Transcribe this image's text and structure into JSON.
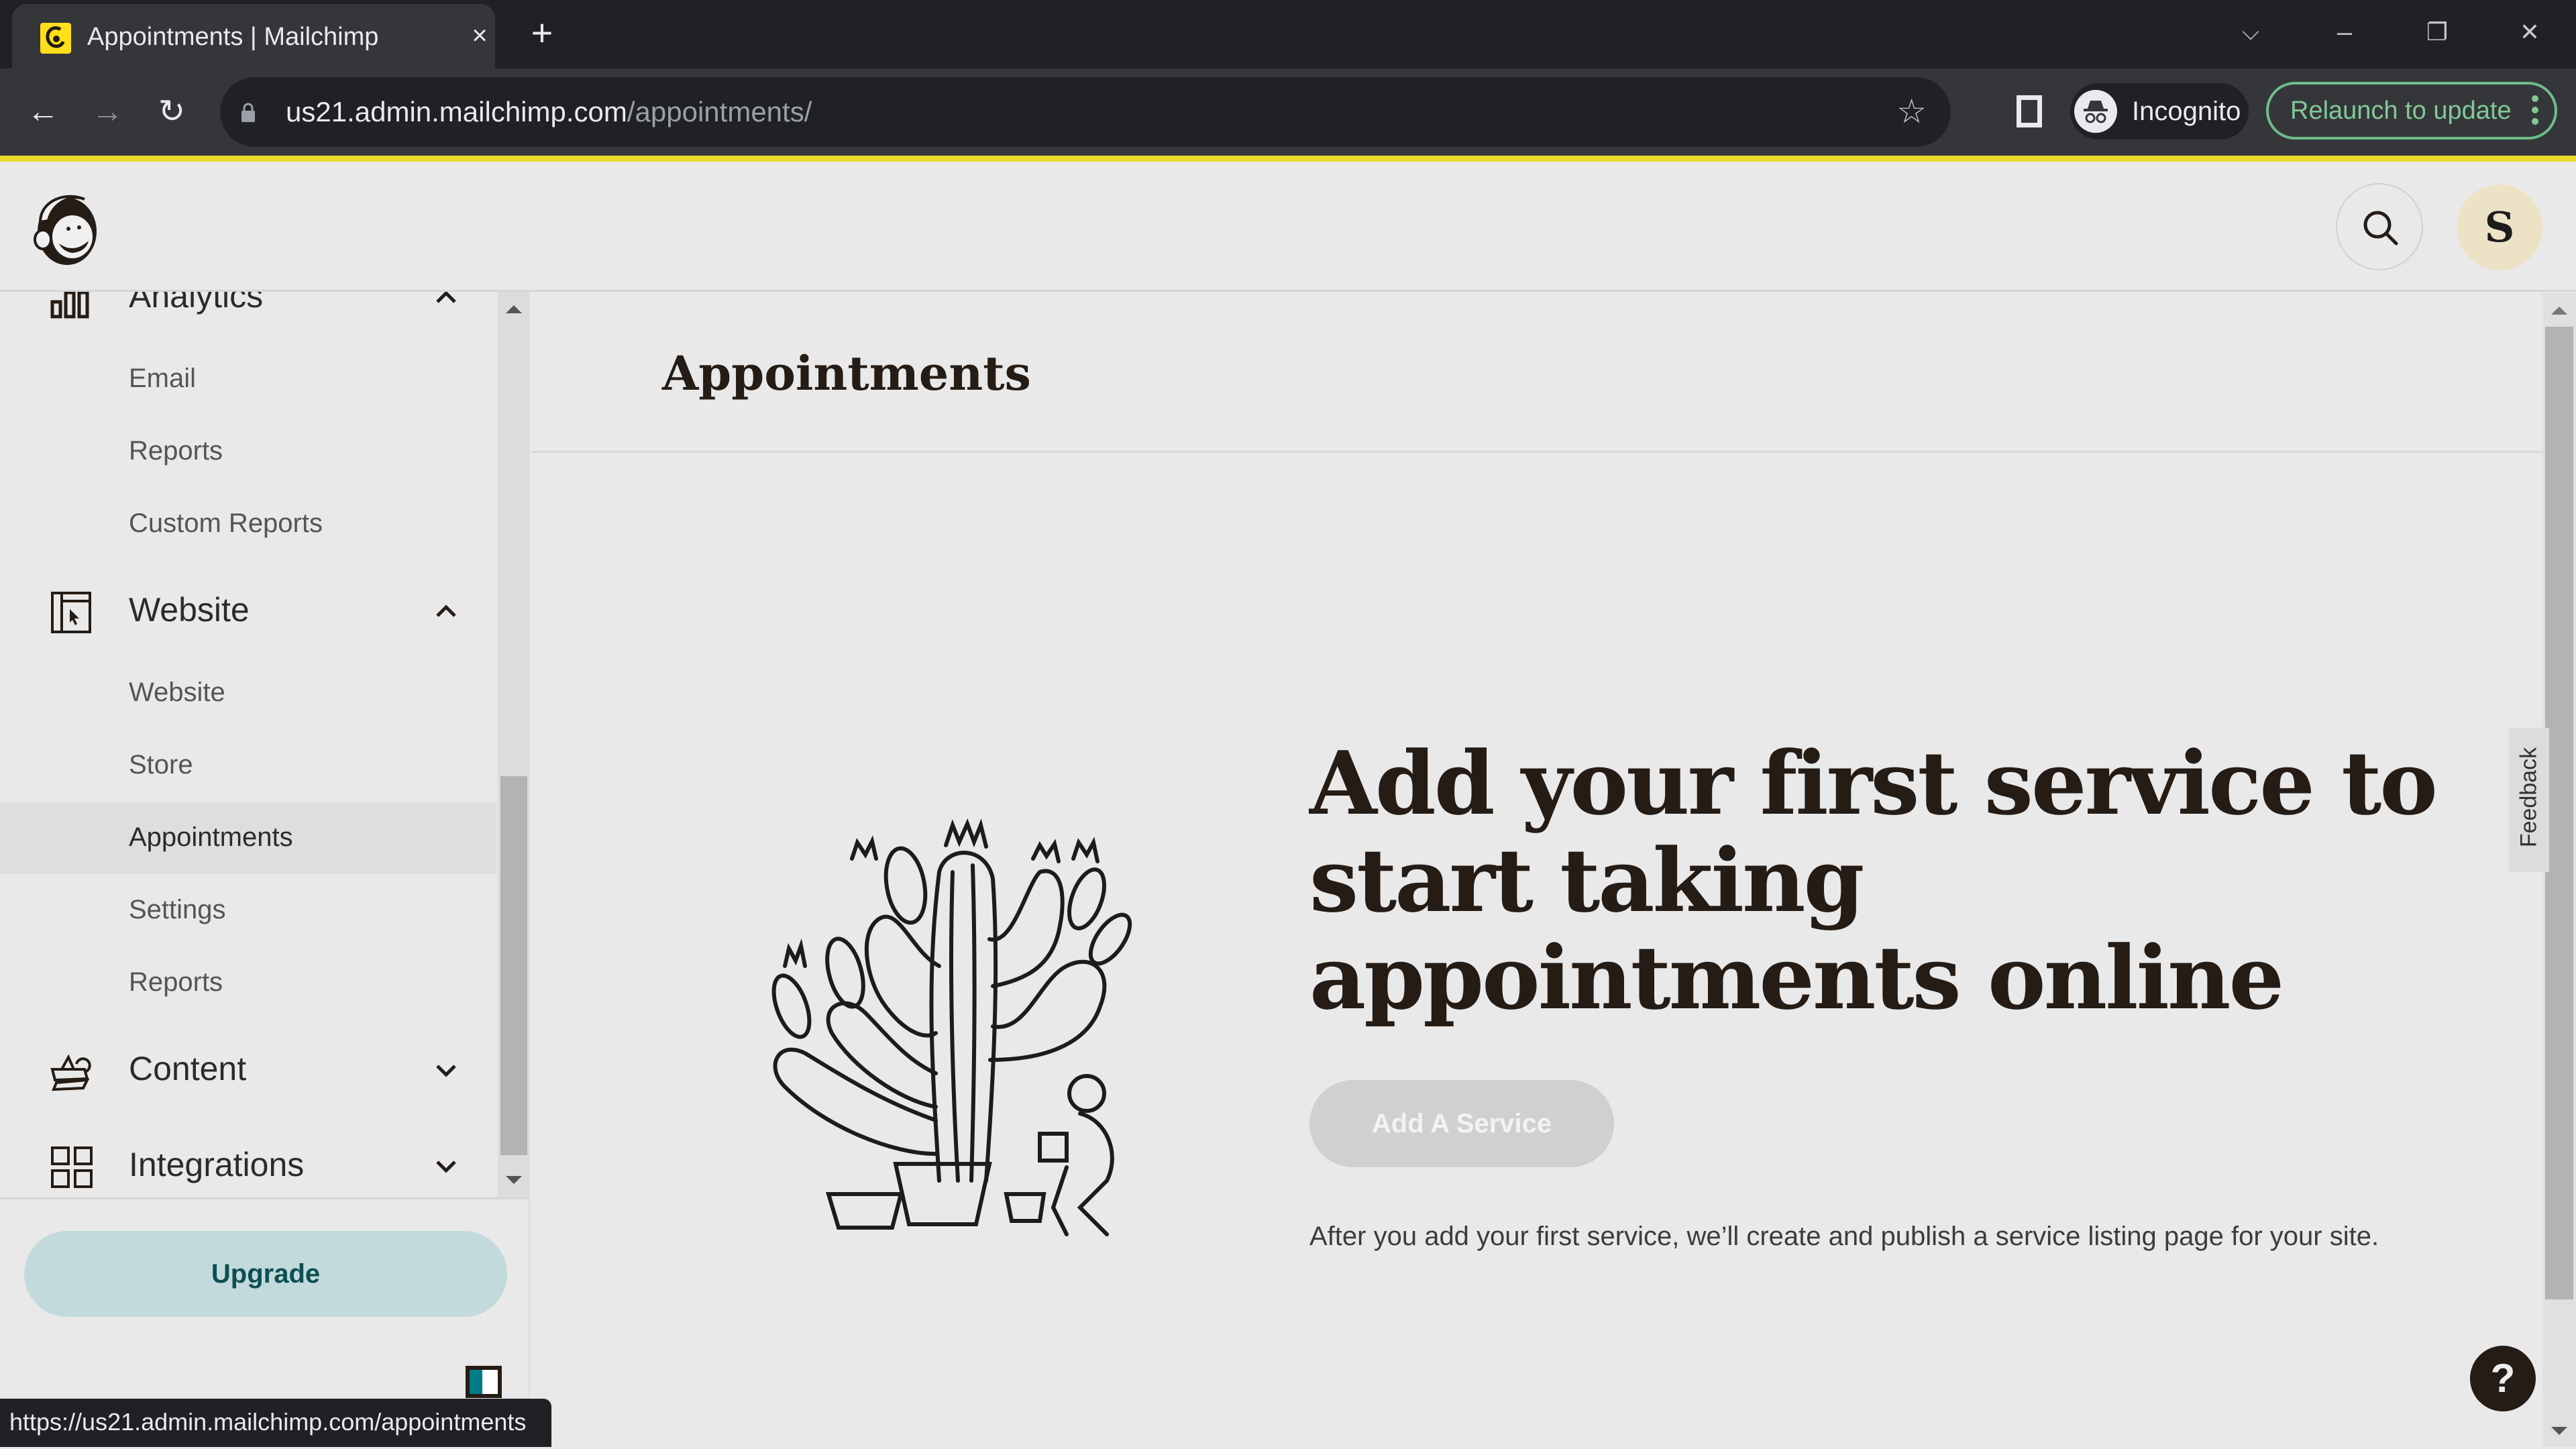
{
  "browser": {
    "tab": {
      "title": "Appointments | Mailchimp",
      "favicon": "mailchimp-favicon",
      "close": "×"
    },
    "new_tab": "+",
    "window_controls": {
      "tab_search": "⌵",
      "minimize": "–",
      "restore": "❐",
      "close": "✕"
    },
    "nav": {
      "back": "←",
      "forward": "→",
      "reload": "↻"
    },
    "url": {
      "host": "us21.admin.mailchimp.com",
      "path": "/appointments/"
    },
    "bookmark": "☆",
    "profile_label": "Incognito",
    "relaunch_label": "Relaunch to update",
    "status_url": "https://us21.admin.mailchimp.com/appointments"
  },
  "header": {
    "logo": "mailchimp-freddie-logo",
    "search_icon": "search-icon",
    "avatar_initial": "S",
    "avatar_color": "#ece3c6"
  },
  "sidebar": {
    "sections": [
      {
        "label": "Analytics",
        "icon": "bar-chart-icon",
        "expanded": true,
        "items": [
          {
            "label": "Email"
          },
          {
            "label": "Reports"
          },
          {
            "label": "Custom Reports"
          }
        ]
      },
      {
        "label": "Website",
        "icon": "website-cursor-icon",
        "expanded": true,
        "items": [
          {
            "label": "Website"
          },
          {
            "label": "Store"
          },
          {
            "label": "Appointments",
            "active": true
          },
          {
            "label": "Settings"
          },
          {
            "label": "Reports"
          }
        ]
      },
      {
        "label": "Content",
        "icon": "content-icon",
        "expanded": false,
        "items": []
      },
      {
        "label": "Integrations",
        "icon": "grid-icon",
        "expanded": false,
        "items": []
      }
    ],
    "upgrade_label": "Upgrade",
    "upgrade_color": "#c2dadb"
  },
  "main": {
    "page_title": "Appointments",
    "headline": "Add your first service to start taking appointments online",
    "cta_label": "Add A Service",
    "cta_disabled": true,
    "description": "After you add your first service, we’ll create and publish a service listing page for your site.",
    "illustration": "cactus-gardener-illustration",
    "feedback_label": "Feedback",
    "help_label": "?"
  }
}
